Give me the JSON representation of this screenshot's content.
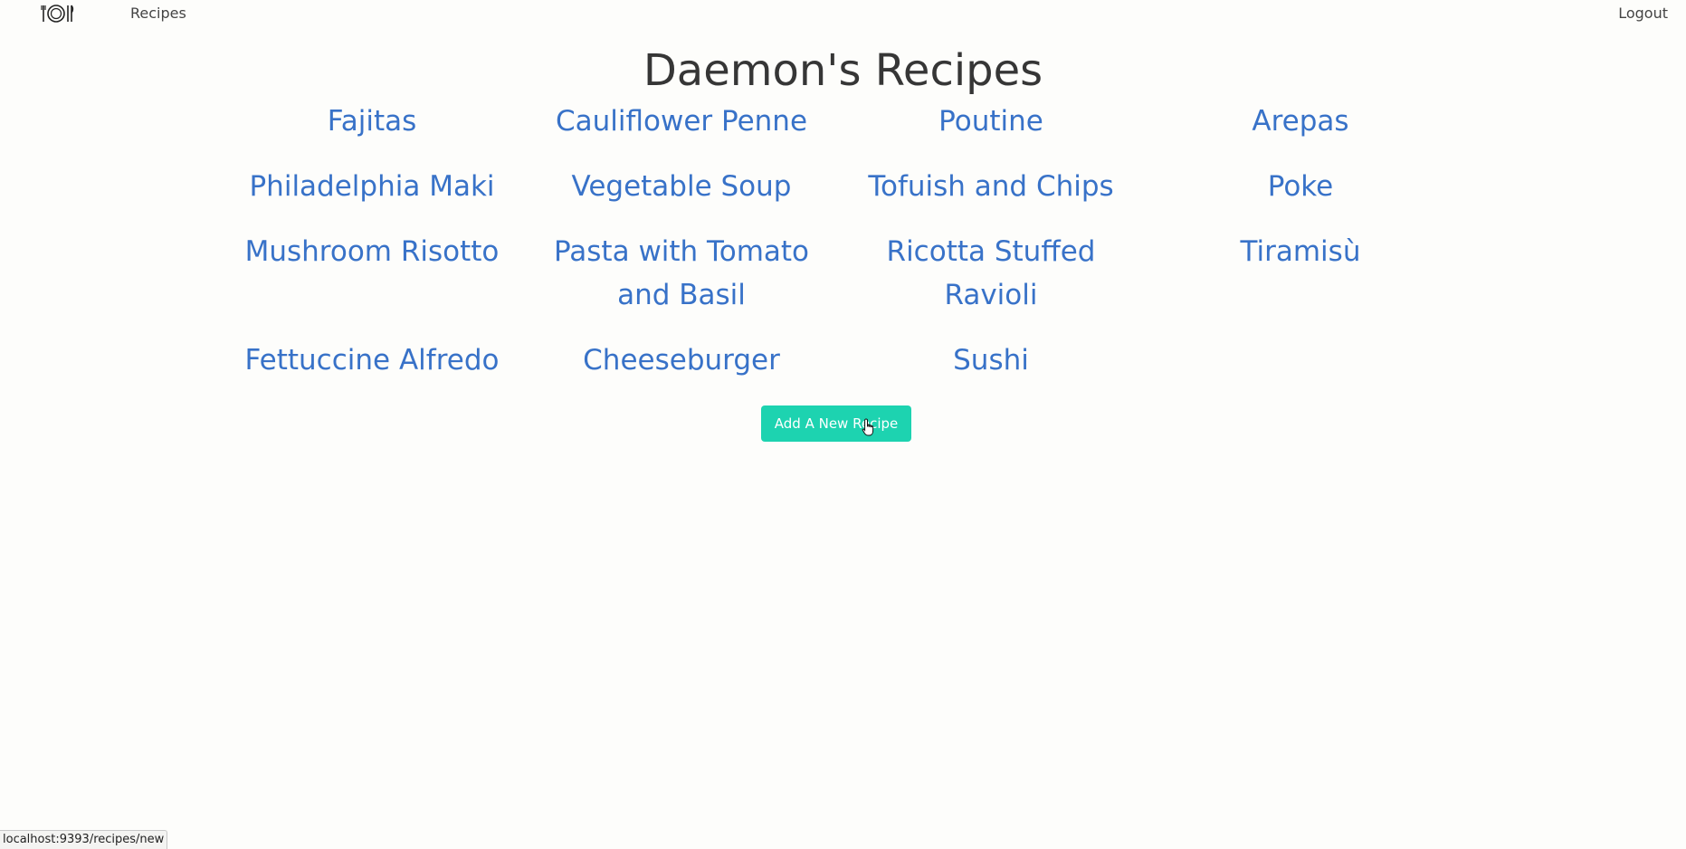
{
  "navbar": {
    "logo_icon": "plate-fork-knife-icon",
    "recipes_label": "Recipes",
    "logout_label": "Logout"
  },
  "main": {
    "title": "Daemon's Recipes",
    "recipes": [
      "Fajitas",
      "Cauliflower Penne",
      "Poutine",
      "Arepas",
      "Philadelphia Maki",
      "Vegetable Soup",
      "Tofuish and Chips",
      "Poke",
      "Mushroom Risotto",
      "Pasta with Tomato and Basil",
      "Ricotta Stuffed Ravioli",
      "Tiramisù",
      "Fettuccine Alfredo",
      "Cheeseburger",
      "Sushi"
    ],
    "add_button_label": "Add A New Recipe"
  },
  "status_bar": {
    "url": "localhost:9393/recipes/new"
  },
  "colors": {
    "background": "#fdfdfb",
    "link": "#3872c8",
    "button": "#1dd3b0",
    "title": "#363636"
  }
}
